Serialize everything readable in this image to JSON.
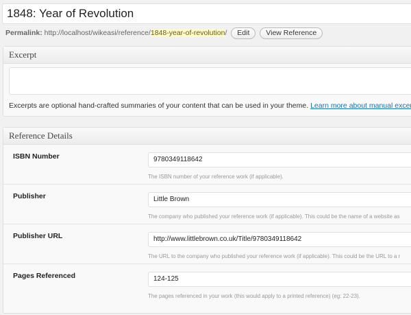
{
  "post": {
    "title": "1848: Year of Revolution"
  },
  "permalink": {
    "label": "Permalink:",
    "base": "http://localhost/wikeasi/reference/",
    "slug": "1848-year-of-revolution",
    "trail": "/",
    "edit_label": "Edit",
    "view_label": "View Reference"
  },
  "excerpt": {
    "title": "Excerpt",
    "value": "",
    "note": "Excerpts are optional hand-crafted summaries of your content that can be used in your theme.",
    "link_text": "Learn more about manual excerpts."
  },
  "reference": {
    "title": "Reference Details",
    "fields": [
      {
        "label": "ISBN Number",
        "value": "9780349118642",
        "desc": "The ISBN number of your reference work (if applicable)."
      },
      {
        "label": "Publisher",
        "value": "Little Brown",
        "desc": "The company who published your reference work (if applicable). This could be the name of a website as"
      },
      {
        "label": "Publisher URL",
        "value": "http://www.littlebrown.co.uk/Title/9780349118642",
        "desc": "The URL to the company who published your reference work (if applicable). This could be the URL to a r"
      },
      {
        "label": "Pages Referenced",
        "value": "124-125",
        "desc": "The pages referenced in your work (this would apply to a printed reference) (eg: 22-23)."
      }
    ]
  }
}
